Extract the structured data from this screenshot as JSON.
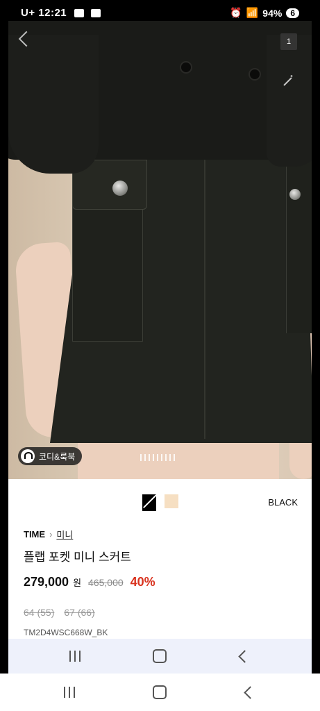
{
  "status_bar": {
    "time": "12:21",
    "carrier": "U+",
    "battery": "94%",
    "notif_count": "6"
  },
  "gallery": {
    "page_indicator": "1",
    "coordi_label": "코디&룩북"
  },
  "product": {
    "selected_color": "BLACK",
    "swatches": [
      {
        "name": "black",
        "hex": "#000000"
      },
      {
        "name": "beige",
        "hex": "#f6dfc2"
      }
    ],
    "brand": "TIME",
    "category": "미니",
    "title": "플랩 포켓 미니 스커트",
    "price": "279,000",
    "currency": "원",
    "original_price": "465,000",
    "discount": "40%",
    "sizes": [
      "64 (55)",
      "67 (66)"
    ],
    "code": "TM2D4WSC668W_BK"
  },
  "colors": {
    "discount": "#d9321e",
    "nav_bg": "#eef1fb"
  },
  "icons": [
    "back-arrow-icon",
    "magic-wand-icon",
    "coordi-person-icon",
    "chevron-right-icon",
    "recent-apps-icon",
    "home-icon",
    "back-icon"
  ]
}
